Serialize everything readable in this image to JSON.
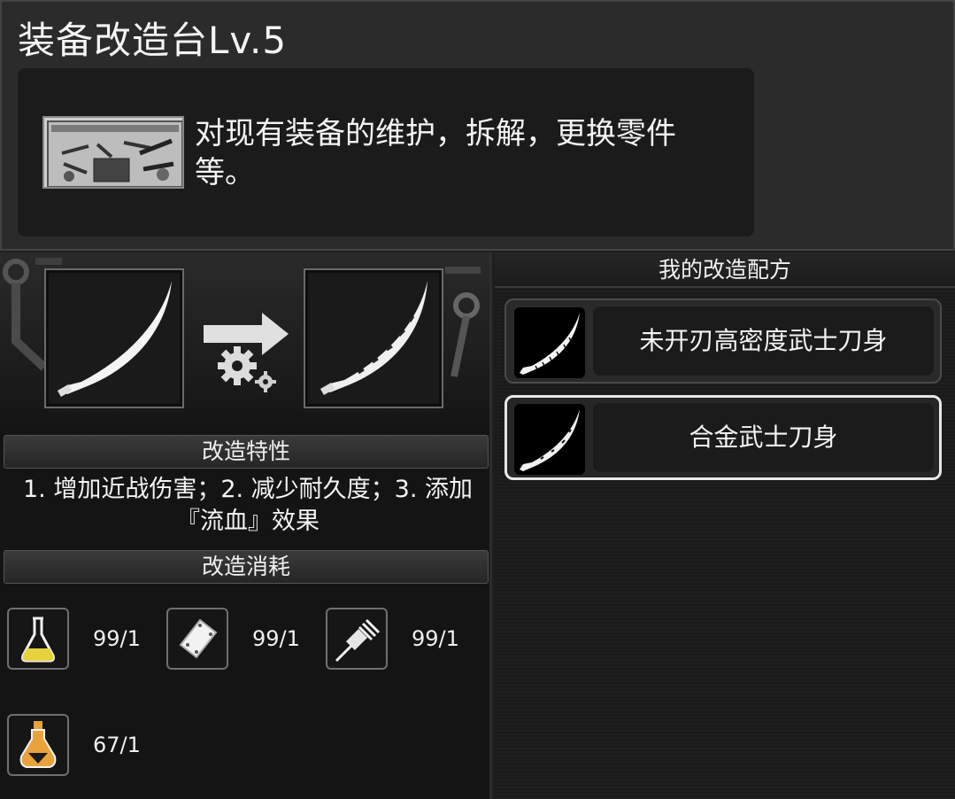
{
  "header": {
    "title": "装备改造台Lv.5",
    "description": "对现有装备的维护，拆解，更换零件等。"
  },
  "modify": {
    "from_item_icon": "katana-blade-plain-icon",
    "to_item_icon": "katana-blade-alloy-icon",
    "traits_label": "改造特性",
    "traits_text": "1. 增加近战伤害；2. 减少耐久度；3. 添加『流血』效果",
    "cost_label": "改造消耗",
    "materials": [
      {
        "icon": "yellow-flask-icon",
        "count": "99/1"
      },
      {
        "icon": "metal-plate-icon",
        "count": "99/1"
      },
      {
        "icon": "drill-part-icon",
        "count": "99/1"
      },
      {
        "icon": "orange-potion-icon",
        "count": "67/1"
      }
    ]
  },
  "recipes": {
    "title": "我的改造配方",
    "items": [
      {
        "name": "未开刃高密度武士刀身",
        "selected": false
      },
      {
        "name": "合金武士刀身",
        "selected": true
      }
    ]
  },
  "colors": {
    "panel_bg": "#1e1e1e",
    "header_bg": "#2b2b2b",
    "text": "#f4f4f4",
    "flask_yellow": "#e6d23a",
    "potion_orange": "#e8a33a"
  }
}
